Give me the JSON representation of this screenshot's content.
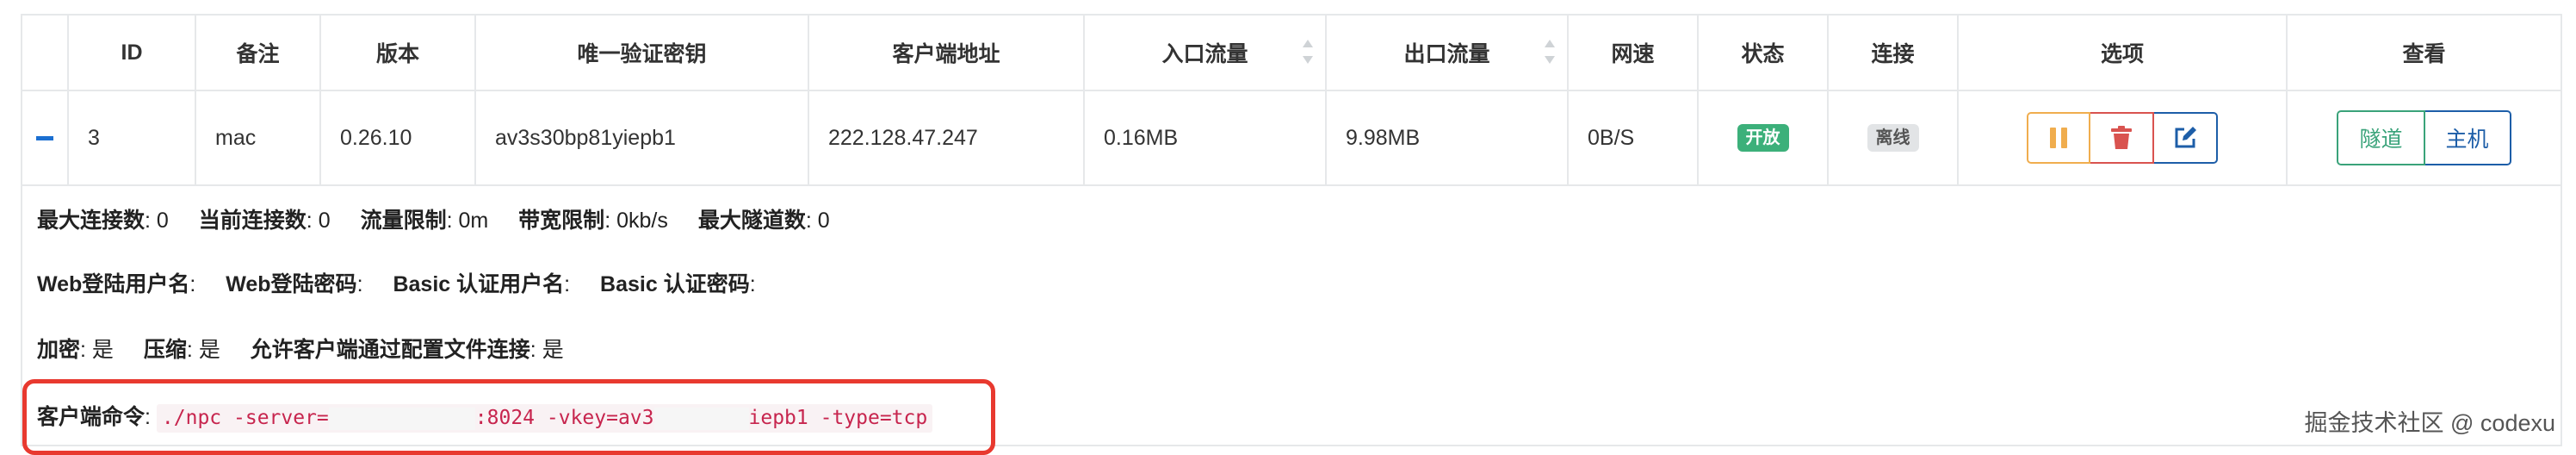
{
  "table": {
    "headers": {
      "id": "ID",
      "remark": "备注",
      "version": "版本",
      "vkey": "唯一验证密钥",
      "client_addr": "客户端地址",
      "inlet_flow": "入口流量",
      "export_flow": "出口流量",
      "speed": "网速",
      "status": "状态",
      "connect": "连接",
      "options": "选项",
      "view": "查看"
    },
    "row": {
      "id": "3",
      "remark": "mac",
      "version": "0.26.10",
      "vkey": "av3s30bp81yiepb1",
      "client_addr": "222.128.47.247",
      "inlet_flow": "0.16MB",
      "export_flow": "9.98MB",
      "speed": "0B/S",
      "status": "开放",
      "connect": "离线",
      "view_tunnel": "隧道",
      "view_host": "主机"
    }
  },
  "details": {
    "line1": [
      {
        "label": "最大连接数",
        "value": "0"
      },
      {
        "label": "当前连接数",
        "value": "0"
      },
      {
        "label": "流量限制",
        "value": "0m"
      },
      {
        "label": "带宽限制",
        "value": "0kb/s"
      },
      {
        "label": "最大隧道数",
        "value": "0"
      }
    ],
    "line2": [
      {
        "label": "Web登陆用户名",
        "value": ""
      },
      {
        "label": "Web登陆密码",
        "value": ""
      },
      {
        "label": "Basic 认证用户名",
        "value": ""
      },
      {
        "label": "Basic 认证密码",
        "value": ""
      }
    ],
    "line3": [
      {
        "label": "加密",
        "value": "是"
      },
      {
        "label": "压缩",
        "value": "是"
      },
      {
        "label": "允许客户端通过配置文件连接",
        "value": "是"
      }
    ],
    "command_label": "客户端命令",
    "command": {
      "part1": "./npc -server=",
      "part2": ":8024 -vkey=av3",
      "part3": "iepb1 -type=tcp"
    }
  },
  "watermark": "掘金技术社区 @ codexu",
  "icons": {
    "collapse": "minus-icon",
    "pause": "pause-icon",
    "delete": "trash-icon",
    "edit": "edit-icon"
  },
  "colors": {
    "status_open": "#3cb07a",
    "offline_badge": "#e2e4e6",
    "pause": "#f0ad4e",
    "delete": "#d9534f",
    "edit": "#1d5ea8",
    "tunnel": "#3aa37a",
    "highlight_border": "#e8392f",
    "code": "#c7254e"
  }
}
